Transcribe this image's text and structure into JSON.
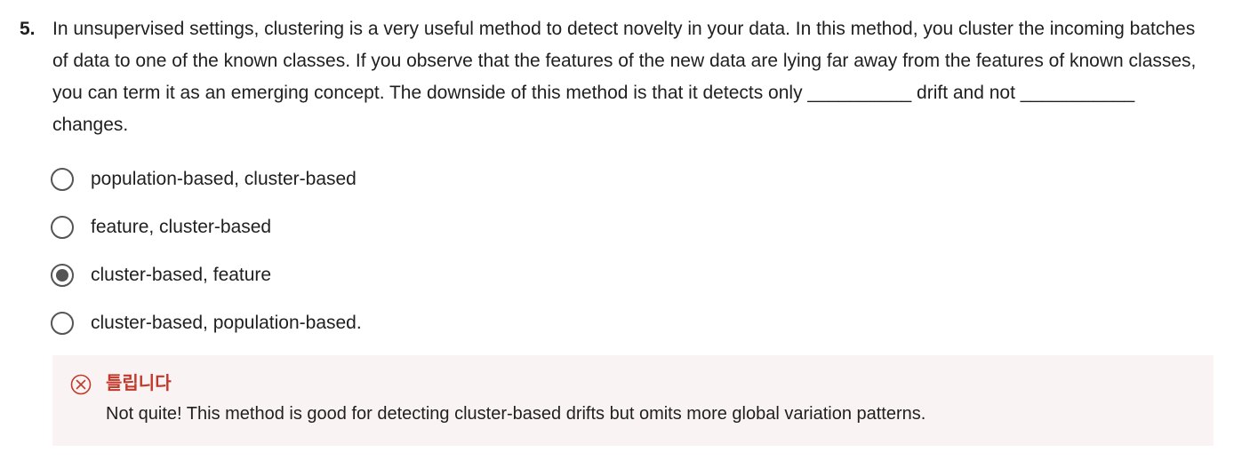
{
  "question": {
    "number": "5.",
    "text": "In unsupervised settings, clustering is a very useful method to detect novelty in your data. In this method, you cluster the incoming batches of data to one of the known classes. If you observe that the features of the new data are lying far away from the features of known classes, you can term it as an emerging concept. The downside of this method is that it detects only __________ drift and not ___________ changes."
  },
  "options": [
    {
      "label": "population-based, cluster-based",
      "selected": false
    },
    {
      "label": "feature, cluster-based",
      "selected": false
    },
    {
      "label": "cluster-based, feature",
      "selected": true
    },
    {
      "label": "cluster-based, population-based.",
      "selected": false
    }
  ],
  "feedback": {
    "title": "틀립니다",
    "text": "Not quite! This method is good for detecting cluster-based drifts but omits more global variation patterns.",
    "icon": "error-circle-x-icon",
    "color": "#c0392b",
    "background": "#faf3f3"
  }
}
